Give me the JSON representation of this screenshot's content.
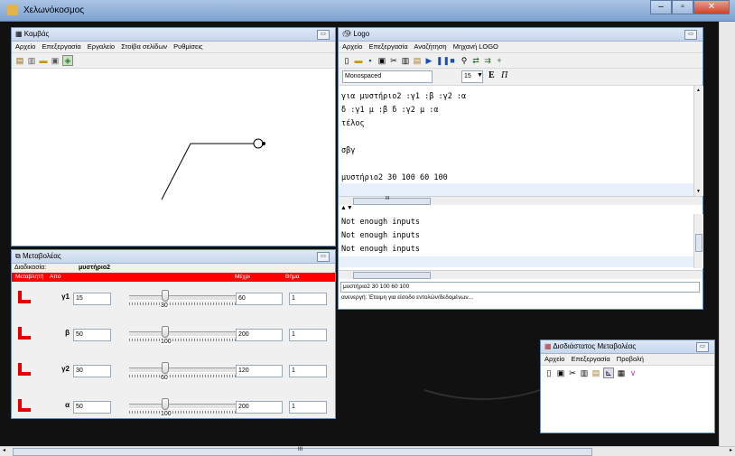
{
  "app_title": "Χελωνόκοσμος",
  "window_controls": {
    "minimize": "–",
    "maximize": "▫",
    "close": "✕"
  },
  "canvas_window": {
    "title": "Καμβάς",
    "menu": [
      "Αρχείο",
      "Επεξεργασία",
      "Εργαλείο",
      "Στοίβα σελίδων",
      "Ρυθμίσεις"
    ]
  },
  "logo_window": {
    "title": "Logo",
    "menu": [
      "Αρχείο",
      "Επεξεργασία",
      "Αναζήτηση",
      "Μηχανή LOGO"
    ],
    "font_name": "Monospaced",
    "font_size": "15",
    "bold_label": "E",
    "italic_label": "Π",
    "editor_lines": [
      "για μυστήριο2 :γ1 :β :γ2 :α",
      "δ :γ1 μ :β δ :γ2 μ :α",
      "τέλος",
      "",
      "σβγ",
      "",
      "μυστήριο2 30 100 60 100"
    ],
    "output_lines": [
      "Not enough inputs",
      "Not enough inputs",
      "Not enough inputs"
    ],
    "command_input": "μυστήριο2 30 100 60 100",
    "status": "ανενεργή: Έτοιμη για είσοδο εντολών/δεδομένων..."
  },
  "variables_window": {
    "title": "Μεταβολέας",
    "procedure_label": "Διαδικασία:",
    "procedure_name": "μυστήριο2",
    "header": {
      "variable": "Μεταβλητή",
      "from": "Από",
      "to": "Μέχρι",
      "step": "Βήμα"
    },
    "rows": [
      {
        "name": "γ1",
        "from": "15",
        "value": "30",
        "to": "60",
        "step": "1",
        "fraction": 0.333
      },
      {
        "name": "β",
        "from": "50",
        "value": "100",
        "to": "200",
        "step": "1",
        "fraction": 0.333
      },
      {
        "name": "γ2",
        "from": "30",
        "value": "60",
        "to": "120",
        "step": "1",
        "fraction": 0.333
      },
      {
        "name": "α",
        "from": "50",
        "value": "100",
        "to": "200",
        "step": "1",
        "fraction": 0.333
      }
    ],
    "accent_color": "#ff0000"
  },
  "dim_window": {
    "title": "Δισδιάστατος Μεταβολέας",
    "menu": [
      "Αρχείο",
      "Επεξεργασία",
      "Προβολή"
    ]
  },
  "scroll_marker": "III"
}
